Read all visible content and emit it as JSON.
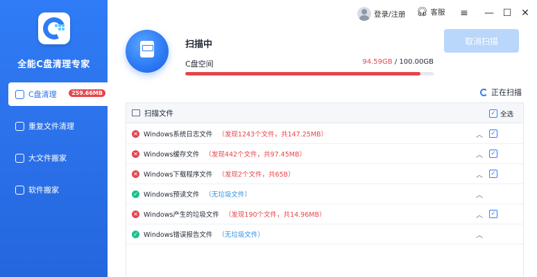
{
  "app": {
    "title": "全能C盘清理专家"
  },
  "sidebar": {
    "items": [
      {
        "label": "C盘清理",
        "badge": "259.66MB"
      },
      {
        "label": "重复文件清理"
      },
      {
        "label": "大文件搬家"
      },
      {
        "label": "软件搬家"
      }
    ]
  },
  "titlebar": {
    "login": "登录/注册",
    "service": "客服",
    "menu_icon": "menu-icon",
    "minimize_icon": "minimize-icon",
    "maximize_icon": "maximize-icon",
    "close_icon": "close-icon"
  },
  "scan": {
    "title": "扫描中",
    "space_label": "C盘空间",
    "used": "94.59GB",
    "separator": " / ",
    "total": "100.00GB",
    "progress_fraction": 0.9459,
    "cancel_label": "取消扫描",
    "status": "正在扫描"
  },
  "panel": {
    "header": "扫描文件",
    "select_all": "全选",
    "rows": [
      {
        "name": "Windows系统日志文件",
        "desc": "（发现1243个文件，共147.25MB）",
        "status": "error",
        "checked": true
      },
      {
        "name": "Windows缓存文件",
        "desc": "（发现442个文件，共97.45MB）",
        "status": "error",
        "checked": true
      },
      {
        "name": "Windows下载程序文件",
        "desc": "（发现2个文件，共65B）",
        "status": "error",
        "checked": true
      },
      {
        "name": "Windows预读文件",
        "desc": "（无垃圾文件）",
        "status": "ok",
        "checked": false
      },
      {
        "name": "Windows产生的垃圾文件",
        "desc": "（发现190个文件，共14.96MB）",
        "status": "error",
        "checked": true
      },
      {
        "name": "Windows错误报告文件",
        "desc": "（无垃圾文件）",
        "status": "ok",
        "checked": false
      }
    ]
  },
  "colors": {
    "accent": "#2f7cf6",
    "danger": "#e5454b",
    "success": "#1fbf8f"
  }
}
